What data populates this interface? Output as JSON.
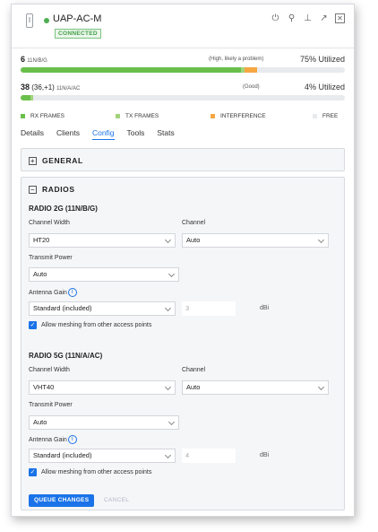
{
  "device": {
    "name": "UAP-AC-M",
    "status": "CONNECTED"
  },
  "header_icons": [
    "power-icon",
    "location-icon",
    "network-icon",
    "popout-icon",
    "close-icon"
  ],
  "radios_usage": [
    {
      "clients": "6",
      "band": "11N/B/G",
      "quality": "(High, likely a problem)",
      "utilization": "75% Utilized",
      "rx_fraction": 0.68,
      "tx_fraction": 0.01,
      "interference_fraction": 0.04
    },
    {
      "clients": "38",
      "extra": "(36,+1)",
      "band": "11N/A/AC",
      "quality": "(Good)",
      "utilization": "4% Utilized",
      "rx_fraction": 0.03,
      "tx_fraction": 0.01,
      "interference_fraction": 0.0
    }
  ],
  "legend": {
    "rx": "RX FRAMES",
    "tx": "TX FRAMES",
    "interference": "INTERFERENCE",
    "free": "FREE"
  },
  "colors": {
    "rx": "#6abf4b",
    "tx": "#a3d37c",
    "interference": "#f5a742",
    "free": "#e8eaed",
    "accent": "#1a73e8",
    "connected": "#4caf50"
  },
  "tabs": [
    "Details",
    "Clients",
    "Config",
    "Tools",
    "Stats"
  ],
  "active_tab": "Config",
  "sections": {
    "general": "GENERAL",
    "radios": "RADIOS"
  },
  "radio_2g": {
    "title": "RADIO 2G (11N/B/G)",
    "channel_width_label": "Channel Width",
    "channel_width": "HT20",
    "channel_label": "Channel",
    "channel": "Auto",
    "tx_power_label": "Transmit Power",
    "tx_power": "Auto",
    "antenna_gain_label": "Antenna Gain",
    "antenna": "Standard (included)",
    "gain_value": "3",
    "gain_unit": "dBi",
    "meshing_label": "Allow meshing from other access points"
  },
  "radio_5g": {
    "title": "RADIO 5G (11N/A/AC)",
    "channel_width_label": "Channel Width",
    "channel_width": "VHT40",
    "channel_label": "Channel",
    "channel": "Auto",
    "tx_power_label": "Transmit Power",
    "tx_power": "Auto",
    "antenna_gain_label": "Antenna Gain",
    "antenna": "Standard (included)",
    "gain_value": "4",
    "gain_unit": "dBi",
    "meshing_label": "Allow meshing from other access points"
  },
  "actions": {
    "queue": "QUEUE CHANGES",
    "cancel": "CANCEL"
  }
}
